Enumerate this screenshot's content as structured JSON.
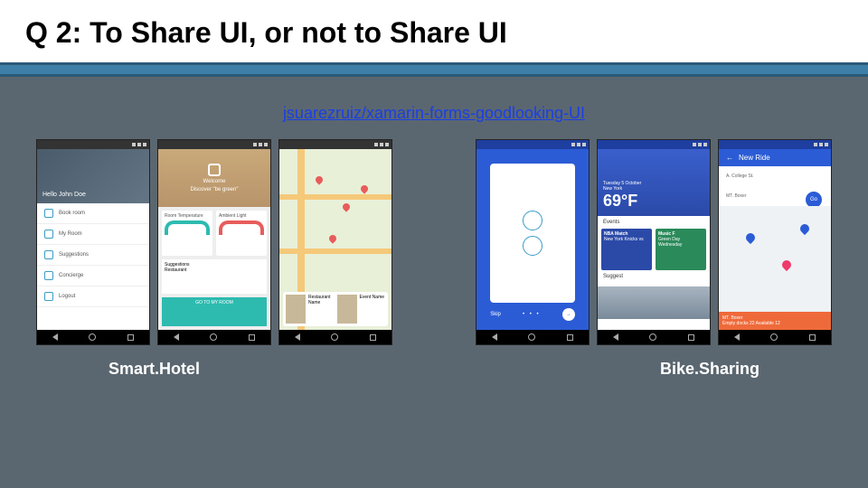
{
  "title": "Q 2: To Share UI, or not to Share UI",
  "link": "jsuarezruiz/xamarin-forms-goodlooking-UI",
  "captions": {
    "left": "Smart.Hotel",
    "right": "Bike.Sharing"
  },
  "phone1": {
    "greeting": "Hello John Doe",
    "items": [
      "Book room",
      "My Room",
      "Suggestions",
      "Concierge",
      "Logout"
    ]
  },
  "phone2": {
    "welcome": "Welcome",
    "discover": "Discover \"be green\"",
    "card_temp": "Room Temperature",
    "card_light": "Ambient Light",
    "suggestions": "Suggestions",
    "restaurant": "Restaurant",
    "go_btn": "GO TO MY ROOM"
  },
  "phone3": {
    "card1": "Restaurant Name",
    "card2": "Event Name"
  },
  "phone4": {
    "skip": "Skip",
    "arrow": "→"
  },
  "phone5": {
    "date": "Tuesday 5 October",
    "city": "New York",
    "temp": "69°F",
    "events_label": "Events",
    "ev1_title": "NBA Match",
    "ev1_sub": "New York Knicks vs",
    "ev2_title": "Music F",
    "ev2_sub": "Green Day Wednesday",
    "suggest_label": "Suggest"
  },
  "phone6": {
    "header": "New Ride",
    "from": "A. College St.",
    "to": "MT. Boxer",
    "go": "Go",
    "footer_title": "MT. Boxer",
    "footer_sub": "Empty docks 22   Available 12"
  }
}
